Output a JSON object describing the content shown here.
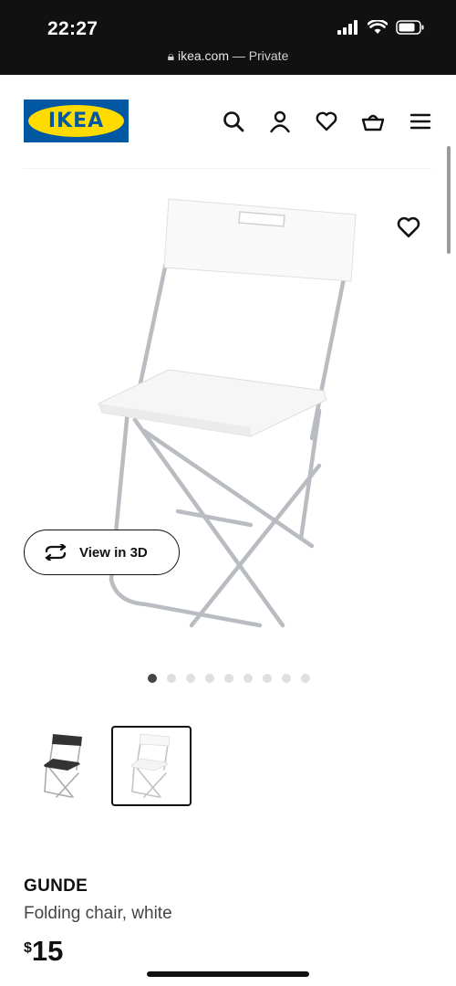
{
  "status_bar": {
    "time": "22:27",
    "url_domain": "ikea.com",
    "url_suffix": " — Private"
  },
  "header": {
    "logo_text": "IKEA",
    "brand_blue": "#0058a3",
    "brand_yellow": "#ffdb00",
    "icons": [
      "search-icon",
      "account-icon",
      "heart-icon",
      "basket-icon",
      "menu-icon"
    ]
  },
  "gallery": {
    "view_3d_label": "View in 3D",
    "dot_count": 9,
    "active_dot": 1,
    "thumbnails": [
      {
        "variant": "black",
        "selected": false
      },
      {
        "variant": "white",
        "selected": true
      }
    ]
  },
  "product": {
    "name": "GUNDE",
    "description": "Folding chair, white",
    "currency": "$",
    "price": "15"
  }
}
